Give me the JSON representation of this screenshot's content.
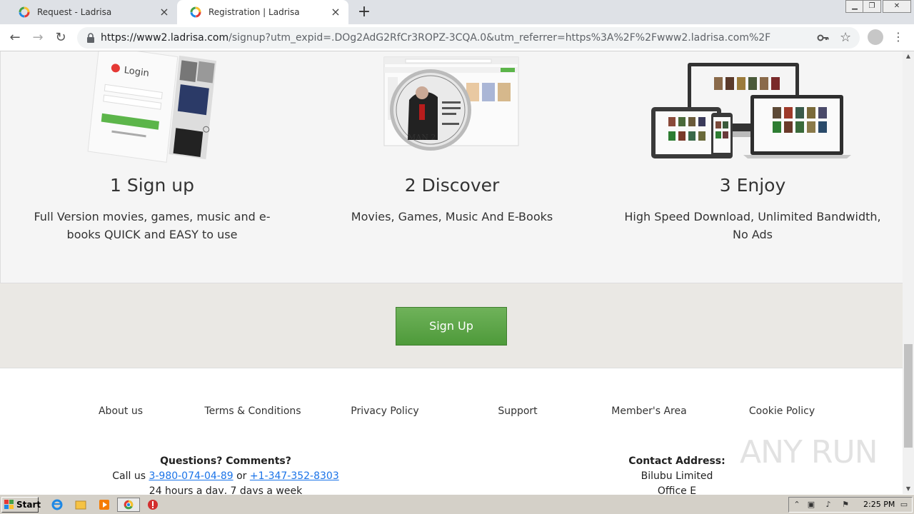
{
  "browser": {
    "tabs": [
      {
        "title": "Request - Ladrisa",
        "active": false
      },
      {
        "title": "Registration | Ladrisa",
        "active": true
      }
    ],
    "new_tab": "+",
    "url_host": "https://www2.ladrisa.com",
    "url_path": "/signup?utm_expid=.DOg2AdG2RfCr3ROPZ-3CQA.0&utm_referrer=https%3A%2F%2Fwww2.ladrisa.com%2F"
  },
  "steps": [
    {
      "title": "1 Sign up",
      "text": "Full Version movies, games, music and e-books QUICK and EASY to use",
      "art_label": "Login"
    },
    {
      "title": "2 Discover",
      "text": "Movies, Games, Music And E-Books",
      "art_label": "MAN 2"
    },
    {
      "title": "3 Enjoy",
      "text": "High Speed Download, Unlimited Bandwidth, No Ads"
    }
  ],
  "cta": {
    "signup_label": "Sign Up"
  },
  "footer": {
    "links": [
      "About us",
      "Terms & Conditions",
      "Privacy Policy",
      "Support",
      "Member's Area",
      "Cookie Policy"
    ],
    "questions": {
      "heading": "Questions? Comments?",
      "call_prefix": "Call us ",
      "phone1": "3-980-074-04-89",
      "or": " or ",
      "phone2": "+1-347-352-8303",
      "hours": "24 hours a day, 7 days a week"
    },
    "address": {
      "heading": "Contact Address:",
      "line1": "Bilubu Limited",
      "line2": "Office E"
    },
    "watermark": "ANY RUN"
  },
  "taskbar": {
    "start_label": "Start",
    "clock": "2:25 PM"
  },
  "colors": {
    "signup_green": "#5ca647",
    "link_blue": "#1a73e8",
    "cta_band": "#eae8e4"
  }
}
